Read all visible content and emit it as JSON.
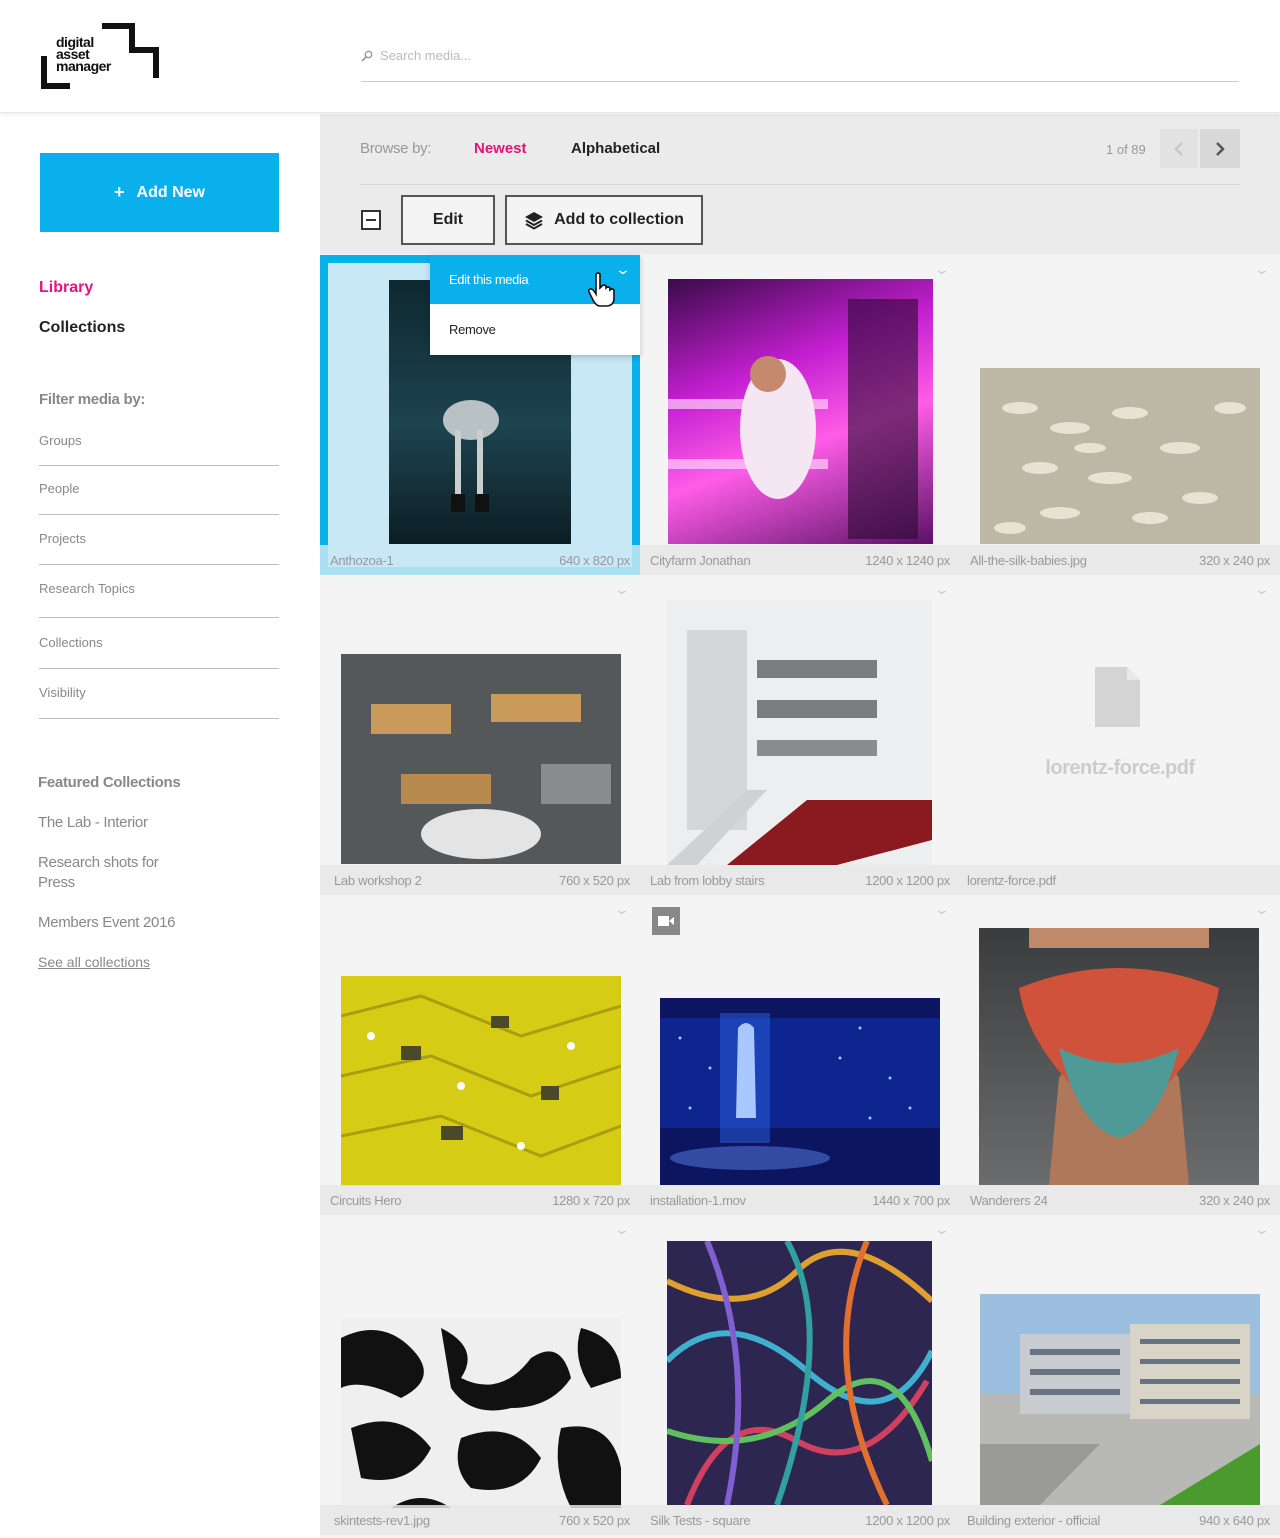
{
  "logo": {
    "line1": "digital",
    "line2": "asset",
    "line3": "manager"
  },
  "search": {
    "placeholder": "Search media..."
  },
  "sidebar": {
    "add_new": "Add New",
    "nav": {
      "library": "Library",
      "collections": "Collections"
    },
    "filter_title": "Filter media by:",
    "filters": [
      "Groups",
      "People",
      "Projects",
      "Research Topics",
      "Collections",
      "Visibility"
    ],
    "featured_title": "Featured Collections",
    "featured": [
      "The Lab - Interior",
      "Research shots for Press",
      "Members Event 2016"
    ],
    "see_all": "See all collections"
  },
  "browse": {
    "label": "Browse by:",
    "newest": "Newest",
    "alphabetical": "Alphabetical",
    "pager": "1 of 89"
  },
  "toolbar": {
    "edit": "Edit",
    "add_to_collection": "Add to collection"
  },
  "dropdown": {
    "edit": "Edit this media",
    "remove": "Remove"
  },
  "media": [
    {
      "name": "Anthozoa-1",
      "size": "640 x 820 px"
    },
    {
      "name": "Cityfarm Jonathan",
      "size": "1240 x 1240 px"
    },
    {
      "name": "All-the-silk-babies.jpg",
      "size": "320 x 240 px"
    },
    {
      "name": "Lab workshop 2",
      "size": "760 x 520 px"
    },
    {
      "name": "Lab from lobby stairs",
      "size": "1200 x 1200 px"
    },
    {
      "name": "lorentz-force.pdf",
      "size": "",
      "placeholder_title": "lorentz-force.pdf"
    },
    {
      "name": "Circuits Hero",
      "size": "1280 x 720 px"
    },
    {
      "name": "installation-1.mov",
      "size": "1440 x 700 px"
    },
    {
      "name": "Wanderers 24",
      "size": "320 x 240 px"
    },
    {
      "name": "skintests-rev1.jpg",
      "size": "760 x 520 px"
    },
    {
      "name": "Silk Tests - square",
      "size": "1200 x 1200 px"
    },
    {
      "name": "Building exterior - official",
      "size": "940 x 640 px"
    }
  ],
  "colors": {
    "accent": "#0ab0ec",
    "pink": "#e5137a"
  }
}
